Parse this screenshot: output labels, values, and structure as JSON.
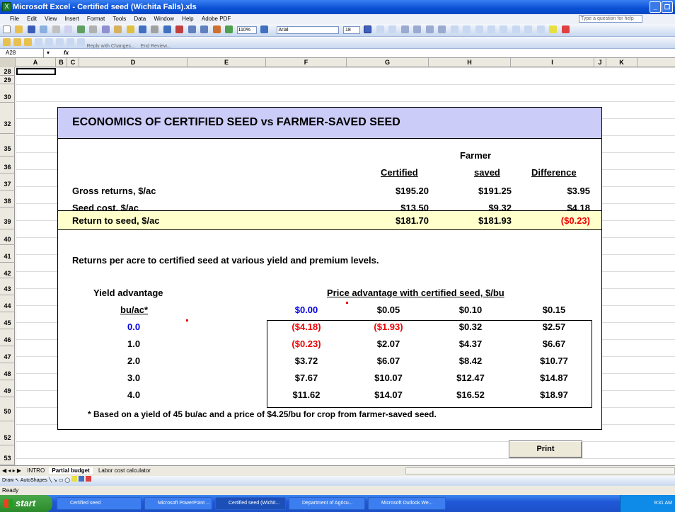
{
  "window": {
    "title": "Microsoft Excel - Certified seed (Wichita Falls).xls"
  },
  "menu": {
    "items": [
      "File",
      "Edit",
      "View",
      "Insert",
      "Format",
      "Tools",
      "Data",
      "Window",
      "Help",
      "Adobe PDF"
    ],
    "ask_placeholder": "Type a question for help"
  },
  "toolbar": {
    "zoom": "110%",
    "font": "Arial",
    "size": "18"
  },
  "reviewbar": {
    "reply_label": "Reply with Changes...",
    "end_review_label": "End Review..."
  },
  "formula_bar": {
    "name_box": "A28",
    "fx": "fx"
  },
  "columns": [
    "A",
    "B",
    "C",
    "D",
    "E",
    "F",
    "G",
    "H",
    "I",
    "J",
    "K"
  ],
  "rows": [
    "28",
    "29",
    "30",
    "32",
    "35",
    "36",
    "37",
    "38",
    "39",
    "40",
    "41",
    "42",
    "43",
    "44",
    "45",
    "46",
    "47",
    "48",
    "49",
    "50",
    "52",
    "53"
  ],
  "sheet": {
    "title": "ECONOMICS OF CERTIFIED SEED vs FARMER-SAVED SEED",
    "col_farmer_top": "Farmer",
    "col_certified": "Certified",
    "col_saved": "saved",
    "col_difference": "Difference",
    "gross": {
      "label": "Gross returns, $/ac",
      "certified": "$195.20",
      "saved": "$191.25",
      "diff": "$3.95"
    },
    "seed": {
      "label": "Seed cost, $/ac",
      "certified": "$13.50",
      "saved": "$9.32",
      "diff": "$4.18"
    },
    "ret": {
      "label": "Return to seed, $/ac",
      "certified": "$181.70",
      "saved": "$181.93",
      "diff": "($0.23)"
    },
    "returns_note": "Returns per acre to certified seed at various yield and premium levels.",
    "yield_adv": "Yield advantage",
    "bu_ac": "bu/ac*",
    "price_adv": "Price advantage with certified seed, $/bu",
    "prices": [
      "$0.00",
      "$0.05",
      "$0.10",
      "$0.15"
    ],
    "yields": [
      "0.0",
      "1.0",
      "2.0",
      "3.0",
      "4.0"
    ],
    "table": [
      [
        "($4.18)",
        "($1.93)",
        "$0.32",
        "$2.57"
      ],
      [
        "($0.23)",
        "$2.07",
        "$4.37",
        "$6.67"
      ],
      [
        "$3.72",
        "$6.07",
        "$8.42",
        "$10.77"
      ],
      [
        "$7.67",
        "$10.07",
        "$12.47",
        "$14.87"
      ],
      [
        "$11.62",
        "$14.07",
        "$16.52",
        "$18.97"
      ]
    ],
    "footnote": "* Based on a yield of 45 bu/ac and a price of $4.25/bu for crop from farmer-saved seed.",
    "print_label": "Print"
  },
  "sheet_tabs": {
    "intro": "INTRO",
    "partial": "Partial budget",
    "labor": "Labor cost calculator"
  },
  "drawbar": {
    "draw": "Draw",
    "autoshapes": "AutoShapes"
  },
  "status": {
    "text": "Ready"
  },
  "taskbar": {
    "start": "start",
    "buttons": [
      "Certified seed",
      "Microsoft PowerPoint ...",
      "Certified seed (Wichit...",
      "Department of Agricu...",
      "Microsoft Outlook We..."
    ],
    "clock": "9:31 AM"
  },
  "colors": {
    "title_band": "#ccccf8",
    "highlight_row": "#ffffcc",
    "negative": "#e00000",
    "blue": "#0000e0"
  }
}
